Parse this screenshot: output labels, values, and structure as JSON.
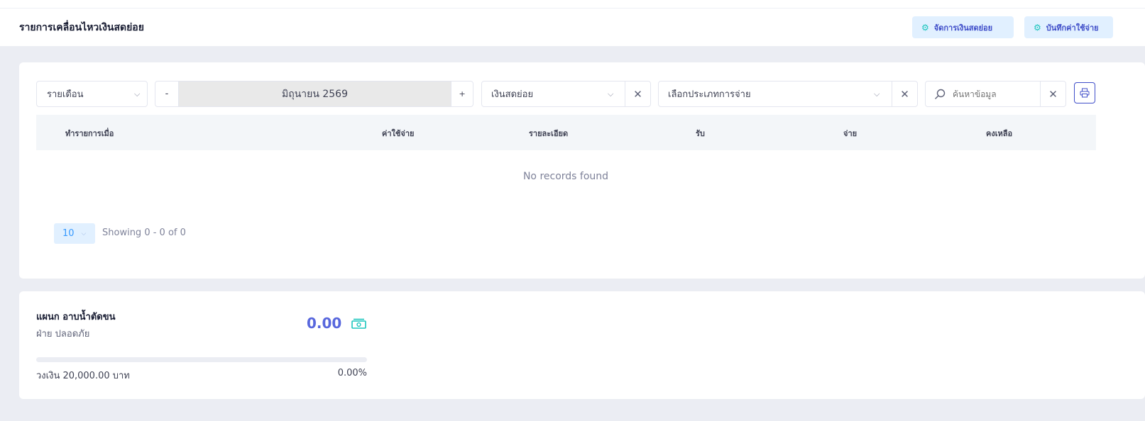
{
  "header": {
    "title": "รายการเคลื่อนไหวเงินสดย่อย",
    "buttons": [
      {
        "label": "จัดการเงินสดย่อย",
        "icon": "gear-icon"
      },
      {
        "label": "บันทึกค่าใช้จ่าย",
        "icon": "gear-icon"
      }
    ]
  },
  "filters": {
    "period": "รายเดือน",
    "minus": "-",
    "month": "มิถุนายน 2569",
    "plus": "+",
    "fund": "เงินสดย่อย",
    "expense_type": "เลือกประเภทการจ่าย",
    "search_placeholder": "ค้นหาข้อมูล"
  },
  "table": {
    "columns": [
      "ทำรายการเมื่อ",
      "ค่าใช้จ่าย",
      "รายละเอียด",
      "รับ",
      "จ่าย",
      "คงเหลือ"
    ],
    "empty_text": "No records found",
    "page_size": "10",
    "showing": "Showing 0 - 0 of 0"
  },
  "summary": {
    "department": "แผนก อาบน้ำตัดขน",
    "division": "ฝ่าย ปลอดภัย",
    "amount": "0.00",
    "budget": "วงเงิน 20,000.00 บาท",
    "percent": "0.00%",
    "progress": 0
  },
  "colors": {
    "accent": "#3699ff",
    "amount": "#5867dd",
    "money_icon": "#1bc5bd"
  }
}
